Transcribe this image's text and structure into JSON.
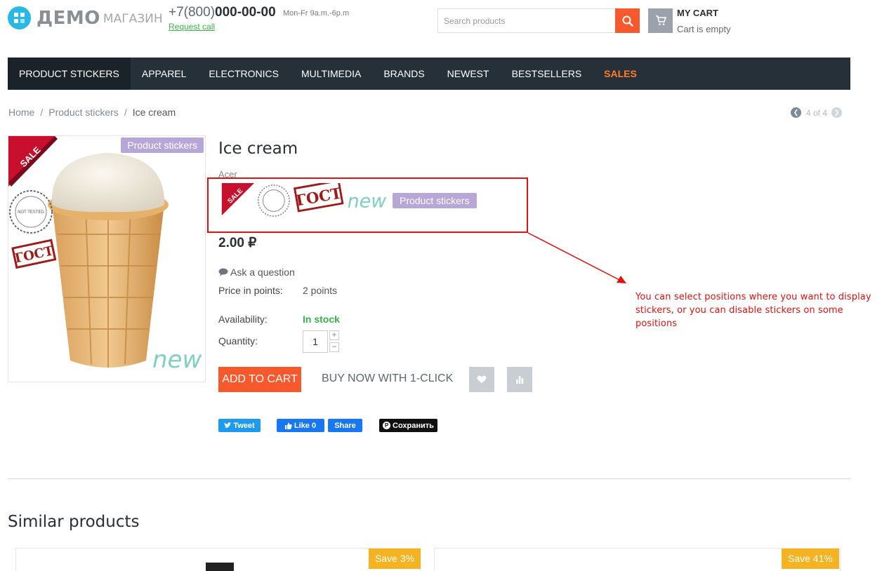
{
  "header": {
    "logo_main": "ДЕМО",
    "logo_sub": "МАГАЗИН",
    "phone_prefix": "+7(800)",
    "phone_number": "000-00-00",
    "hours": "Mon-Fr 9a.m.-6p.m",
    "request_call": "Request call",
    "search_placeholder": "Search products",
    "cart_title": "MY CART",
    "cart_status": "Cart is empty"
  },
  "nav": {
    "items": [
      "PRODUCT STICKERS",
      "APPAREL",
      "ELECTRONICS",
      "MULTIMEDIA",
      "BRANDS",
      "NEWEST",
      "BESTSELLERS",
      "SALES"
    ]
  },
  "breadcrumb": {
    "home": "Home",
    "category": "Product stickers",
    "current": "Ice cream"
  },
  "pager": {
    "text": "4 of 4"
  },
  "product": {
    "title": "Ice cream",
    "brand": "Acer",
    "sticker_badge": "Product stickers",
    "image_badge": "Product stickers",
    "sticker_sale": "SALE",
    "sticker_gost": "ГОСТ",
    "sticker_new": "new",
    "sticker_not_tested": "NOT TESTED ON ANIMALS",
    "price": "2.00 ₽",
    "ask_question": "Ask a question",
    "points_label": "Price in points:",
    "points_value": "2 points",
    "availability_label": "Availability:",
    "availability_value": "In stock",
    "quantity_label": "Quantity:",
    "quantity_value": "1",
    "add_to_cart": "ADD TO CART",
    "buy_now": "BUY NOW WITH 1-CLICK"
  },
  "share": {
    "tweet": "Tweet",
    "like": "Like 0",
    "share": "Share",
    "save": "Сохранить"
  },
  "annotation": {
    "note": "You can select positions where you want to display stickers, or you can disable stickers on some positions"
  },
  "similar": {
    "title": "Similar products",
    "badges": [
      "Save 3%",
      "Save 41%"
    ]
  },
  "colors": {
    "accent": "#f7592d",
    "nav_bg": "#263039",
    "sales": "#ff7d29",
    "in_stock": "#35b44a",
    "sticker_purple": "#b7a6d8",
    "annotation_red": "#e31010",
    "save_badge": "#f5b321"
  }
}
